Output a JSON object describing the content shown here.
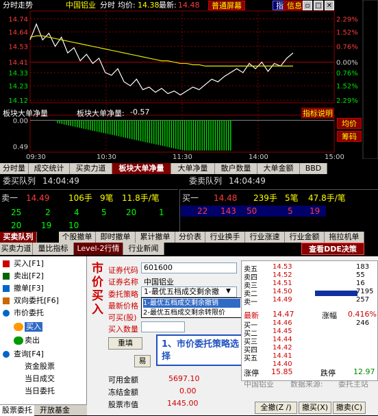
{
  "chart_data": [
    {
      "type": "line",
      "title": "分时走势",
      "x": [
        "09:30",
        "10:30",
        "11:30",
        "14:00",
        "15:00"
      ],
      "series": [
        {
          "name": "分时",
          "values": [
            14.58,
            14.7,
            14.58,
            14.63,
            14.53,
            14.6,
            14.48,
            14.52,
            14.42,
            14.47,
            14.4,
            14.44,
            14.33,
            14.31,
            14.36,
            14.26,
            14.23,
            14.28,
            14.2,
            14.22,
            14.18,
            14.21,
            14.17,
            14.19,
            14.16,
            14.19,
            14.22,
            14.2,
            14.24,
            14.28,
            14.26,
            14.3,
            14.33,
            14.36,
            14.33,
            14.4,
            14.36,
            14.41,
            14.34,
            14.4,
            14.38,
            14.44,
            14.48
          ]
        },
        {
          "name": "均价",
          "values": [
            14.6,
            14.61,
            14.61,
            14.6,
            14.59,
            14.58,
            14.57,
            14.56,
            14.55,
            14.54,
            14.53,
            14.52,
            14.51,
            14.5,
            14.49,
            14.48,
            14.47,
            14.46,
            14.45,
            14.44,
            14.43,
            14.42,
            14.42,
            14.41,
            14.4,
            14.4,
            14.39,
            14.39,
            14.38,
            14.38,
            14.38,
            14.38,
            14.38,
            14.38,
            14.38,
            14.38,
            14.38,
            14.38,
            14.38,
            14.38,
            14.38,
            14.38,
            14.38
          ]
        }
      ],
      "ylim": [
        14.1,
        14.8
      ],
      "yticks_left": [
        "14.74",
        "14.64",
        "14.53",
        "14.41",
        "14.33",
        "14.23",
        "14.12"
      ],
      "yticks_right": [
        "2.29%",
        "1.52%",
        "0.76%",
        "0.00%",
        "0.76%",
        "1.52%",
        "2.29%"
      ],
      "grid": true
    },
    {
      "type": "bar",
      "title": "板块大单净量",
      "values_ref": "单柱均为负值",
      "yticks": [
        "0.00",
        "0.49"
      ],
      "ylim": [
        -0.6,
        0.1
      ],
      "last_value": -0.57
    }
  ],
  "header": {
    "title": "分时走势",
    "stock": "中国铝业",
    "mode": "分时",
    "avg_label": "均价:",
    "avg_value": "14.38",
    "last_label": "最新:",
    "last_value": "14.48",
    "screen_btn": "普通屏幕",
    "btn_zhi": "指",
    "btn_info": "信息"
  },
  "lower_header": {
    "title": "板块大单净量",
    "label": "板块大单净量:",
    "value": "-0.57",
    "help": "指标说明",
    "side_btn1": "均价",
    "side_btn2": "筹码"
  },
  "xaxis": [
    "09:30",
    "10:30",
    "11:30",
    "14:00",
    "15:00"
  ],
  "tabs1": [
    "分时量",
    "成交统计",
    "买卖力道",
    "板块大单净量",
    "大单净量",
    "散户数量",
    "大单金额",
    "BBD"
  ],
  "queue": {
    "buy_title": "委买队列",
    "buy_time": "14:04:49",
    "sell_title": "委卖队列",
    "sell_time": "14:04:49",
    "sell1_label": "卖一",
    "sell1_price": "14.49",
    "sell1_vol": "106手",
    "sell1_cnt": "9笔",
    "sell1_avg": "11.8手/笔",
    "buy1_label": "买一",
    "buy1_price": "14.48",
    "buy1_vol": "239手",
    "buy1_cnt": "5笔",
    "buy1_avg": "47.8手/笔",
    "sell_orders_row1": [
      "25",
      "2",
      "4",
      "5",
      "20",
      "1"
    ],
    "sell_orders_row2": [
      "20",
      "19",
      "10"
    ],
    "buy_orders": [
      "22",
      "143",
      "50",
      "5",
      "19"
    ]
  },
  "tabs2": [
    "买卖队列",
    "个股撤单",
    "即时撤单",
    "累计撤单",
    "分价表",
    "行业换手",
    "行业涨速",
    "行业金额",
    "拖拉机单"
  ],
  "tabs3": [
    "买卖力道",
    "量比指标",
    "Level-2行情",
    "行业新闻"
  ],
  "dde_btn": "查看DDE决策",
  "tree": {
    "items": [
      "买入[F1]",
      "卖出[F2]",
      "撤单[F3]",
      "双向委托[F6]",
      "市价委托",
      "买入",
      "卖出",
      "查询[F4]",
      "资金股票",
      "当日成交",
      "当日委托"
    ],
    "tab1": "股票委托",
    "tab2": "开放基金"
  },
  "form": {
    "side_title": "市价买入",
    "code_label": "证券代码",
    "code_value": "601600",
    "name_label": "证券名称",
    "name_value": "中国铝业",
    "strategy_label": "委托策略",
    "strategy_value": "1-最优五档成交剩余撤",
    "price_label": "最新价格",
    "can_buy_label": "可买(股)",
    "qty_label": "买入数量",
    "options": [
      "1-最优五档成交剩余撤销",
      "2-最优五档成交剩余转限价"
    ],
    "reset_btn": "重填",
    "avail_label": "可用金额",
    "avail_value": "5697.10",
    "frozen_label": "冻结金额",
    "frozen_value": "0.00",
    "mkt_label": "股票市值",
    "mkt_value": "1445.00",
    "callout_text": "1、市价委托策略选择",
    "shortcut": "易"
  },
  "orderbook": {
    "sells": [
      {
        "label": "卖五",
        "price": "14.53",
        "vol": "183"
      },
      {
        "label": "卖四",
        "price": "14.52",
        "vol": "55"
      },
      {
        "label": "卖三",
        "price": "14.51",
        "vol": "16"
      },
      {
        "label": "卖二",
        "price": "14.50",
        "vol": "7195"
      },
      {
        "label": "卖一",
        "price": "14.49",
        "vol": "257"
      }
    ],
    "last_label": "最新",
    "last_price": "14.47",
    "change_label": "涨幅",
    "change_value": "0.416%",
    "buys": [
      {
        "label": "买一",
        "price": "14.46",
        "vol": "246"
      },
      {
        "label": "买二",
        "price": "14.45",
        "vol": ""
      },
      {
        "label": "买三",
        "price": "14.44",
        "vol": ""
      },
      {
        "label": "买四",
        "price": "14.42",
        "vol": ""
      },
      {
        "label": "买五",
        "price": "14.41",
        "vol": ""
      },
      {
        "label": "",
        "price": "14.40",
        "vol": ""
      }
    ],
    "rise_label": "涨停",
    "rise_value": "15.85",
    "fall_label": "跌停",
    "fall_value": "12.97",
    "name": "中国铝业",
    "source_label": "数据来源:",
    "source_value": "委托主站"
  },
  "bottom_btns": [
    "全撤(Z /)",
    "撤买(X)",
    "撤卖(C)"
  ],
  "colors": {
    "up": "#ff3c3c",
    "down": "#00e000",
    "grid": "#8b0000",
    "avg": "#e6e600",
    "price": "#ffffff"
  }
}
